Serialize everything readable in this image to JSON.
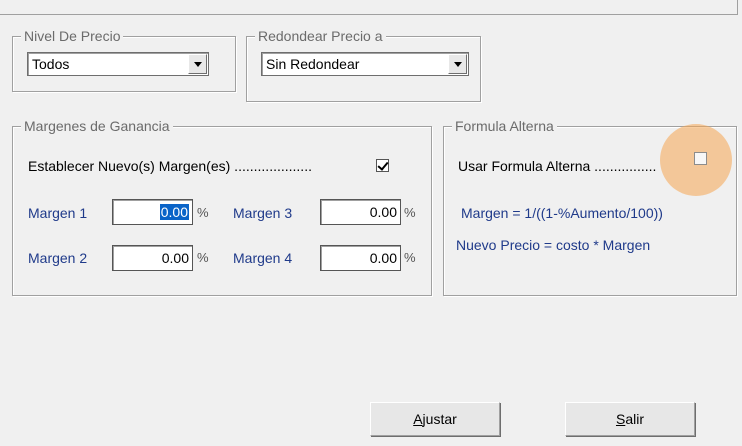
{
  "nivel_precio": {
    "legend": "Nivel De Precio",
    "value": "Todos"
  },
  "redondear": {
    "legend": "Redondear Precio a",
    "value": "Sin Redondear"
  },
  "margenes": {
    "legend": "Margenes de Ganancia",
    "establecer_label": "Establecer Nuevo(s) Margen(es) ....................",
    "establecer_checked": true,
    "fields": [
      {
        "label": "Margen 1",
        "value": "0.00",
        "suffix": "%"
      },
      {
        "label": "Margen 2",
        "value": "0.00",
        "suffix": "%"
      },
      {
        "label": "Margen 3",
        "value": "0.00",
        "suffix": "%"
      },
      {
        "label": "Margen 4",
        "value": "0.00",
        "suffix": "%"
      }
    ]
  },
  "formula": {
    "legend": "Formula Alterna",
    "usar_label": "Usar Formula Alterna ................",
    "usar_checked": false,
    "line1": "Margen = 1/((1-%Aumento/100))",
    "line2": "Nuevo Precio = costo * Margen"
  },
  "buttons": {
    "ajustar_first": "A",
    "ajustar_rest": "justar",
    "salir_first": "S",
    "salir_rest": "alir"
  },
  "colors": {
    "highlight": "#f5a652",
    "label_blue": "#1f3a8a",
    "selection": "#0a64c8"
  }
}
